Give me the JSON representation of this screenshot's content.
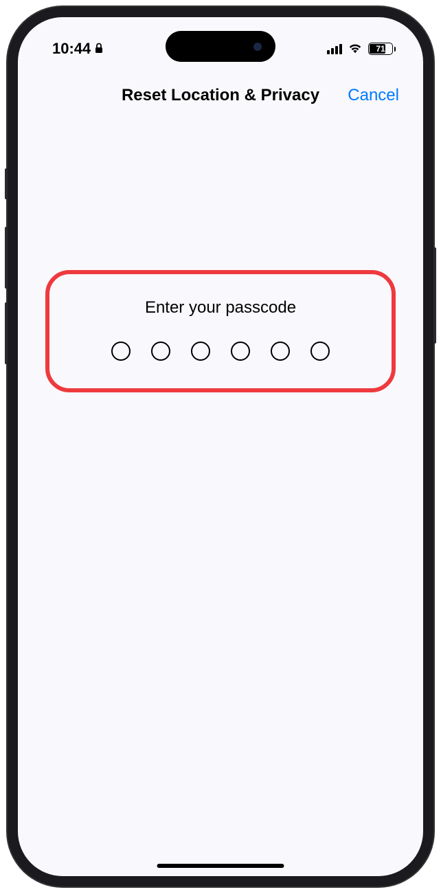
{
  "status_bar": {
    "time": "10:44",
    "battery_level": "71"
  },
  "nav": {
    "title": "Reset Location & Privacy",
    "cancel_label": "Cancel"
  },
  "passcode": {
    "prompt": "Enter your passcode",
    "digit_count": 6
  }
}
